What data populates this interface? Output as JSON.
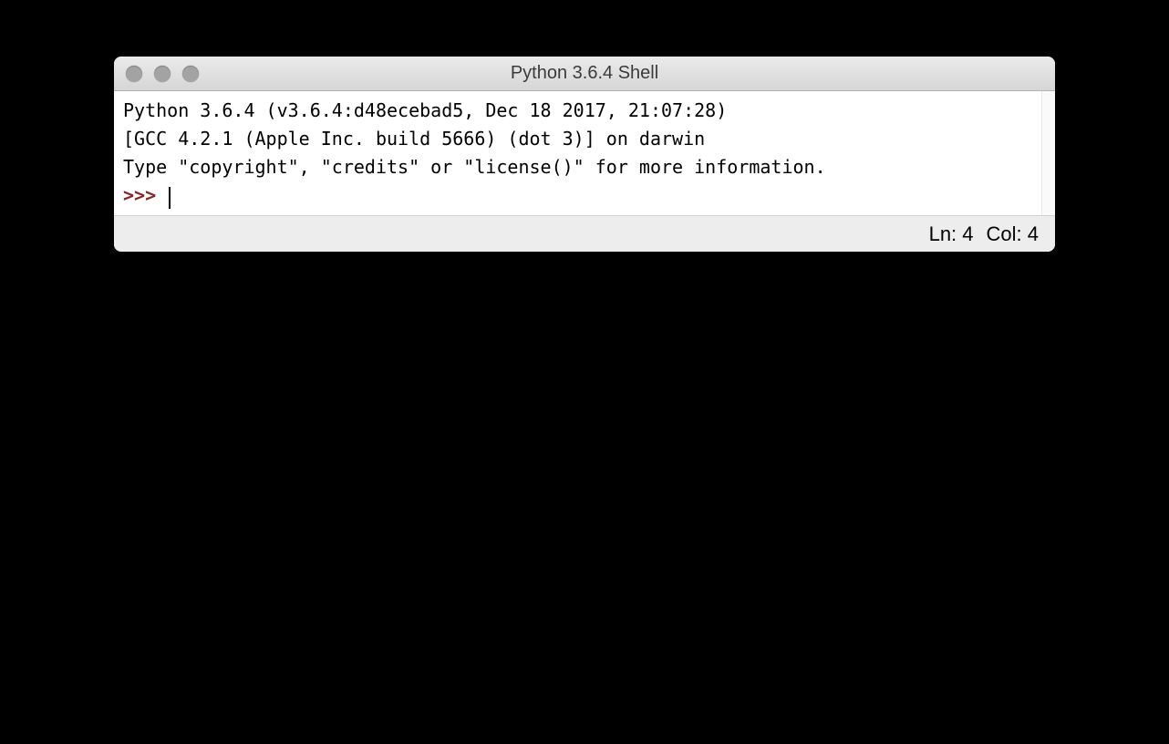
{
  "window": {
    "title": "Python 3.6.4 Shell"
  },
  "shell": {
    "line1": "Python 3.6.4 (v3.6.4:d48ecebad5, Dec 18 2017, 21:07:28) ",
    "line2": "[GCC 4.2.1 (Apple Inc. build 5666) (dot 3)] on darwin",
    "line3": "Type \"copyright\", \"credits\" or \"license()\" for more information.",
    "prompt": ">>> "
  },
  "status": {
    "line": "Ln: 4",
    "col": "Col: 4"
  }
}
